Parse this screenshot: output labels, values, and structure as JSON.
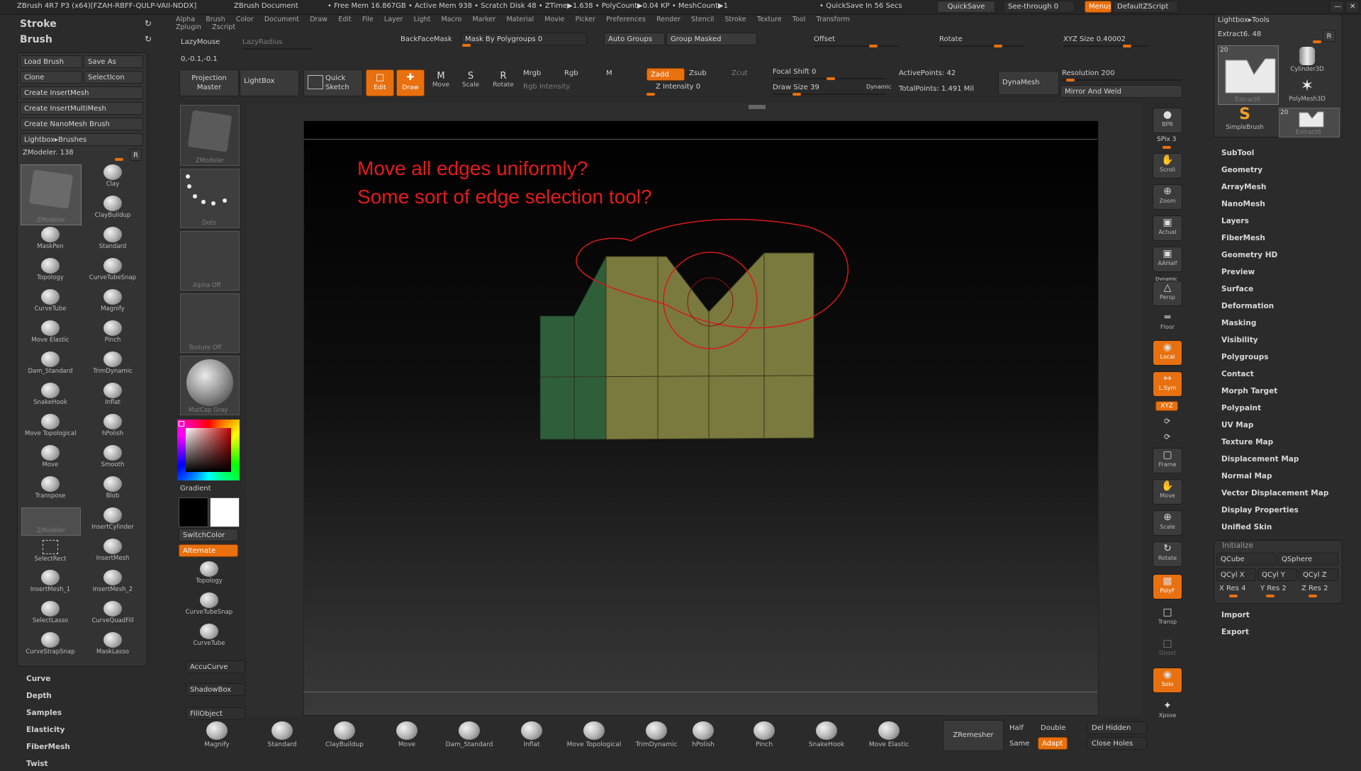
{
  "titlebar": {
    "app": "ZBrush 4R7 P3 (x64)[FZAH-RBFF-QULP-VAII-NDDX]",
    "document": "ZBrush Document",
    "stats": "• Free Mem 16.867GB • Active Mem 938 • Scratch Disk 48 • ZTime▶1.638 • PolyCount▶0.04 KP • MeshCount▶1",
    "quicksave_info": "• QuickSave In 56 Secs",
    "quicksave_btn": "QuickSave",
    "see_through": "See-through  0",
    "menus_btn": "Menus",
    "default_script": "DefaultZScript"
  },
  "menubar": [
    "Alpha",
    "Brush",
    "Color",
    "Document",
    "Draw",
    "Edit",
    "File",
    "Layer",
    "Light",
    "Macro",
    "Marker",
    "Material",
    "Movie",
    "Picker",
    "Preferences",
    "Render",
    "Stencil",
    "Stroke",
    "Texture",
    "Tool",
    "Transform",
    "Zplugin",
    "Zscript"
  ],
  "left_top": {
    "stroke": "Stroke",
    "brush": "Brush"
  },
  "brush_panel": {
    "buttons": [
      "Load Brush",
      "Save As",
      "Clone",
      "SelectIcon",
      "Create InsertMesh",
      "Create InsertMultiMesh",
      "Create NanoMesh Brush",
      "Lightbox▸Brushes"
    ],
    "current": "ZModeler. 138",
    "r_btn": "R",
    "grid": [
      [
        "ZModeler",
        "Clay"
      ],
      [
        "",
        "ClayBuildup"
      ],
      [
        "MaskPen",
        "Standard"
      ],
      [
        "Topology",
        "CurveTubeSnap"
      ],
      [
        "CurveTube",
        "Magnify"
      ],
      [
        "Move Elastic",
        "Pinch"
      ],
      [
        "Dam_Standard",
        "TrimDynamic"
      ],
      [
        "SnakeHook",
        "Inflat"
      ],
      [
        "Move Topological",
        "hPolish"
      ],
      [
        "Move",
        "Smooth"
      ],
      [
        "Transpose",
        "Blob"
      ],
      [
        "ZModeler",
        "InsertCylinder"
      ],
      [
        "SelectRect",
        "InsertMesh"
      ],
      [
        "InsertMesh_1",
        "InsertMesh_2"
      ],
      [
        "SelectLasso",
        "CurveQuadFill"
      ],
      [
        "CurveStrapSnap",
        "MaskLasso"
      ]
    ]
  },
  "left_sub": [
    "Curve",
    "Depth",
    "Samples",
    "Elasticity",
    "FiberMesh",
    "Twist"
  ],
  "toolbar": {
    "lazymouse": "LazyMouse",
    "lazyradius": "LazyRadius",
    "coords": "0,-0.1,-0.1",
    "backface": "BackFaceMask",
    "mask_by_poly": "Mask By Polygroups 0",
    "auto_groups": "Auto Groups",
    "group_masked": "Group Masked",
    "offset": "Offset",
    "rotate": "Rotate",
    "xyz_size": "XYZ Size 0.40002",
    "projection_master": "Projection Master",
    "lightbox": "LightBox",
    "quick_sketch": "Quick Sketch",
    "edit": "Edit",
    "draw": "Draw",
    "move": "Move",
    "scale": "Scale",
    "rotate2": "Rotate",
    "mrgb": "Mrgb",
    "rgb": "Rgb",
    "m": "M",
    "rgb_intensity": "Rgb Intensity",
    "zadd": "Zadd",
    "zsub": "Zsub",
    "zcut": "Zcut",
    "z_intensity": "Z Intensity 0",
    "focal_shift": "Focal Shift 0",
    "draw_size": "Draw Size 39",
    "dynamic": "Dynamic",
    "active_points": "ActivePoints: 42",
    "total_points": "TotalPoints: 1.491 Mil",
    "dynamesh": "DynaMesh",
    "resolution": "Resolution 200",
    "mirror_weld": "Mirror And Weld"
  },
  "left_col2": {
    "zmodeler_thumb": "ZModeler",
    "dots": "Dots",
    "alpha": "Alpha Off",
    "texture": "Texture Off",
    "matcap": "MatCap Gray",
    "gradient": "Gradient",
    "switch_color": "SwitchColor",
    "alternate": "Alternate",
    "brushes": [
      "Topology",
      "CurveTubeSnap",
      "CurveTube"
    ],
    "accucurve": "AccuCurve",
    "shadowbox": "ShadowBox",
    "fillobject": "FillObject"
  },
  "canvas": {
    "line1": "Move all edges uniformly?",
    "line2": "Some sort of edge selection tool?"
  },
  "right_strip": [
    {
      "name": "BPR",
      "icon": "●",
      "orange": false
    },
    {
      "name": "Scroll",
      "icon": "✋",
      "orange": false
    },
    {
      "name": "Zoom",
      "icon": "⊕",
      "orange": false
    },
    {
      "name": "Actual",
      "icon": "▣",
      "orange": false
    },
    {
      "name": "AAHalf",
      "icon": "▣",
      "orange": false
    },
    {
      "name": "Persp",
      "icon": "△",
      "orange": false
    },
    {
      "name": "Floor",
      "icon": "═",
      "orange": false
    },
    {
      "name": "Local",
      "icon": "◉",
      "orange": true
    },
    {
      "name": "L.Sym",
      "icon": "↔",
      "orange": true
    },
    {
      "name": "Frame",
      "icon": "▢",
      "orange": false
    },
    {
      "name": "Move",
      "icon": "✋",
      "orange": false
    },
    {
      "name": "Scale",
      "icon": "⊕",
      "orange": false
    },
    {
      "name": "Rotate",
      "icon": "↻",
      "orange": false
    },
    {
      "name": "PolyF",
      "icon": "▦",
      "orange": true
    },
    {
      "name": "Transp",
      "icon": "□",
      "orange": false
    },
    {
      "name": "Ghost",
      "icon": "□",
      "orange": false
    },
    {
      "name": "Solo",
      "icon": "◉",
      "orange": true
    },
    {
      "name": "Xpose",
      "icon": "✦",
      "orange": false
    }
  ],
  "spix": "SPix 3",
  "xyz": "XYZ",
  "dynamic_label": "Dynamic",
  "tool_panel": {
    "header": "Lightbox▸Tools",
    "current": "Extract6. 48",
    "r_btn": "R",
    "thumbs": [
      "Extract6",
      "Cylinder3D",
      "PolyMesh3D",
      "SimpleBrush",
      "Extract6"
    ],
    "count1": "20",
    "count2": "20"
  },
  "right_menu": [
    "SubTool",
    "Geometry",
    "ArrayMesh",
    "NanoMesh",
    "Layers",
    "FiberMesh",
    "Geometry HD",
    "Preview",
    "Surface",
    "Deformation",
    "Masking",
    "Visibility",
    "Polygroups",
    "Contact",
    "Morph Target",
    "Polypaint",
    "UV Map",
    "Texture Map",
    "Displacement Map",
    "Normal Map",
    "Vector Displacement Map",
    "Display Properties",
    "Unified Skin"
  ],
  "initialize": {
    "title": "Initialize",
    "qcube": "QCube",
    "qsphere": "QSphere",
    "qcylx": "QCyl X",
    "qcyly": "QCyl Y",
    "qcylz": "QCyl Z",
    "xres": "X Res 4",
    "yres": "Y Res 2",
    "zres": "Z Res 2"
  },
  "right_bottom": [
    "Import",
    "Export"
  ],
  "bottom_shelf": [
    "Magnify",
    "Standard",
    "ClayBuildup",
    "Move",
    "Dam_Standard",
    "Inflat",
    "Move Topological",
    "TrimDynamic",
    "hPolish",
    "Pinch",
    "SnakeHook",
    "Move Elastic"
  ],
  "bottom_right": {
    "zremesher": "ZRemesher",
    "half": "Half",
    "double": "Double",
    "same": "Same",
    "adapt": "Adapt",
    "del_hidden": "Del Hidden",
    "close_holes": "Close Holes"
  }
}
